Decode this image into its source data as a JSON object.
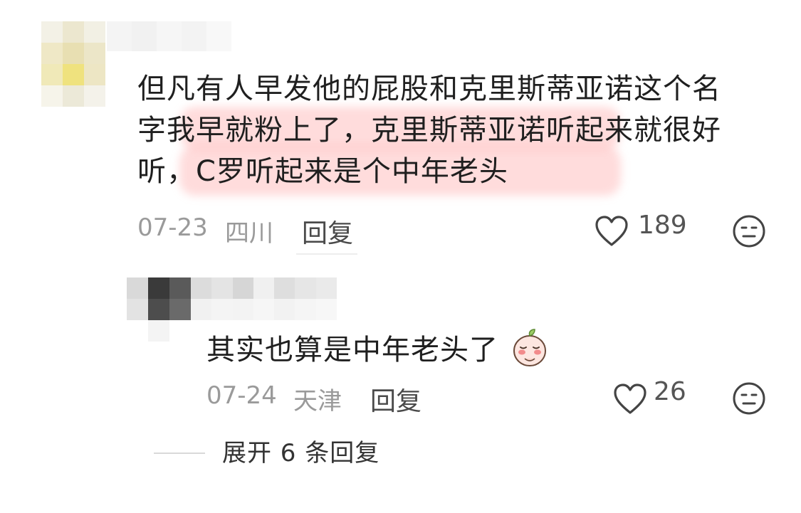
{
  "comment": {
    "text_lines": [
      "但凡有人早发他的屁股和克里斯蒂亚诺这个名",
      "字我早就粉上了，克里斯蒂亚诺听起来就很好",
      "听，C罗听起来是个中年老头"
    ],
    "date": "07-23",
    "location": "四川",
    "reply_label": "回复",
    "likes": "189"
  },
  "reply": {
    "text": "其实也算是中年老头了",
    "date": "07-24",
    "location": "天津",
    "reply_label": "回复",
    "likes": "26"
  },
  "expand": {
    "label": "展开 6 条回复"
  },
  "colors": {
    "highlight": "#ffb3b3",
    "meta_gray": "#9a9a9a",
    "divider": "#d9d9d9"
  },
  "icons": [
    "heart-icon",
    "emoji-face-icon",
    "peach-sticker-icon"
  ]
}
